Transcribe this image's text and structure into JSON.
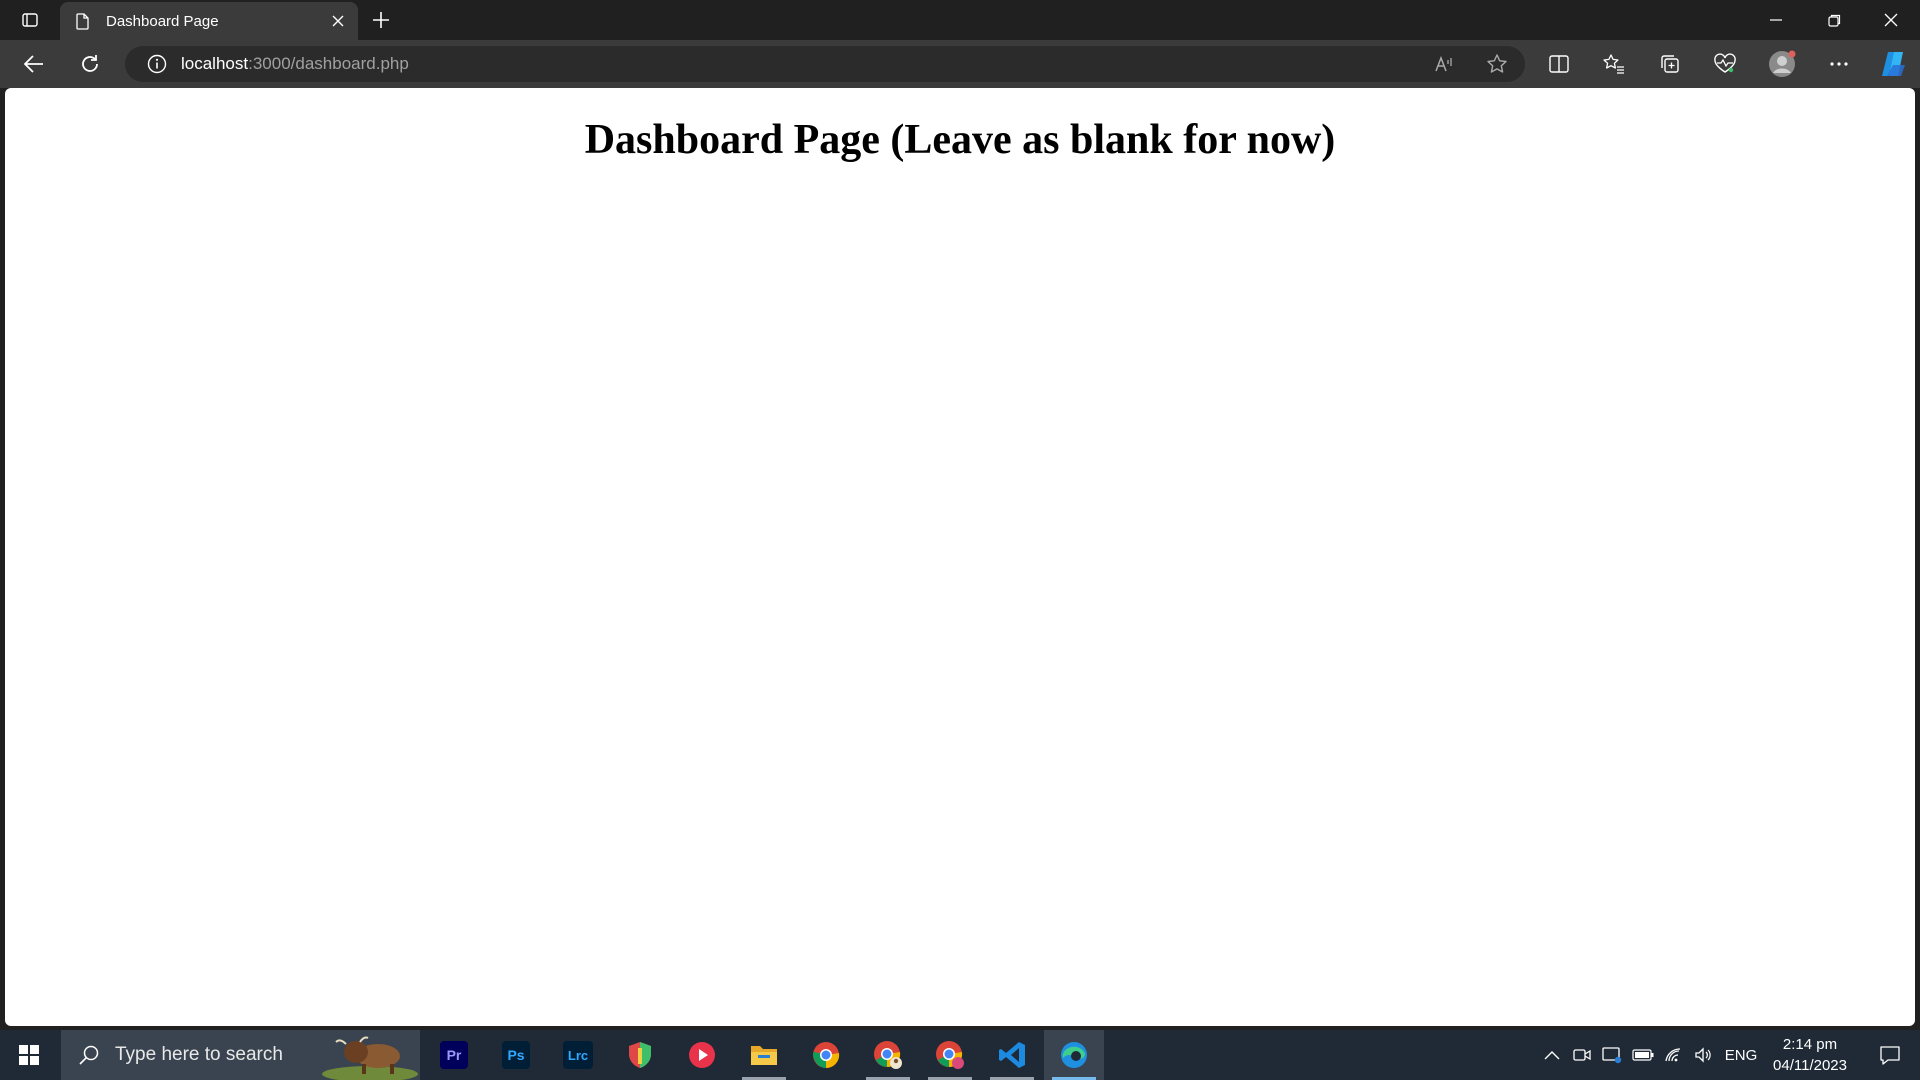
{
  "browser": {
    "tab": {
      "title": "Dashboard Page"
    },
    "address": {
      "host": "localhost",
      "path": ":3000/dashboard.php"
    }
  },
  "page": {
    "heading": "Dashboard Page (Leave as blank for now)"
  },
  "taskbar": {
    "search_placeholder": "Type here to search",
    "apps": [
      {
        "name": "Premiere Pro",
        "label": "Pr"
      },
      {
        "name": "Photoshop",
        "label": "Ps"
      },
      {
        "name": "Lightroom Classic",
        "label": "Lrc"
      }
    ],
    "language": "ENG",
    "time": "2:14 pm",
    "date": "04/11/2023"
  },
  "colors": {
    "tabbar_bg": "#202020",
    "toolbar_bg": "#3b3b3b",
    "taskbar_bg": "#1f2a36",
    "page_bg": "#ffffff",
    "edge_blue": "#1f8fe0"
  }
}
